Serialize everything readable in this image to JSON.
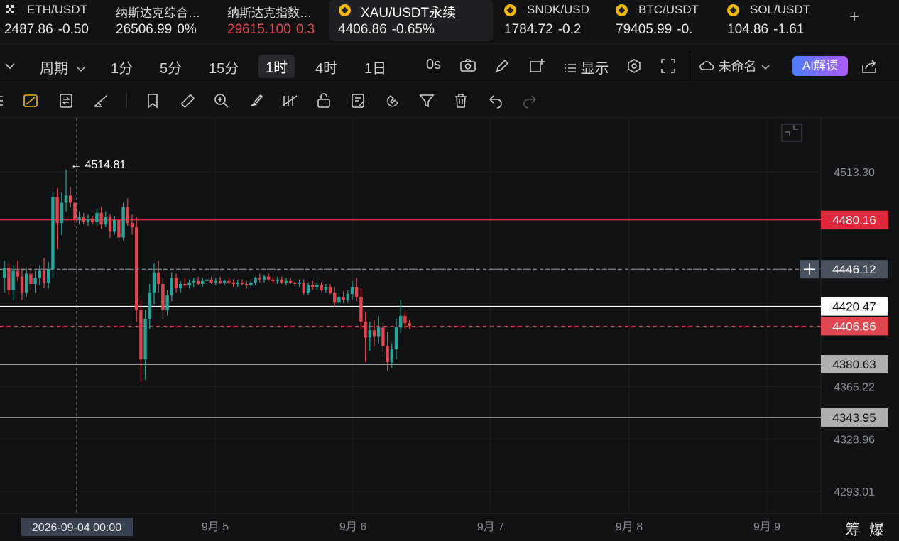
{
  "tickers": [
    {
      "name": "ETH/USDT",
      "price": "2487.86",
      "change": "-0.50",
      "change_color": "#e8e8e8",
      "price_color": "#e8e8e8",
      "icon": "grid-icon"
    },
    {
      "name": "纳斯达克综合…",
      "price": "26506.99",
      "change": "0%",
      "change_color": "#e8e8e8",
      "price_color": "#e8e8e8",
      "icon": ""
    },
    {
      "name": "纳斯达克指数…",
      "price": "29615.100",
      "change": "0.3",
      "change_color": "#e0464f",
      "price_color": "#e0464f",
      "icon": ""
    },
    {
      "name": "XAU/USDT永续",
      "price": "4406.86",
      "change": "-0.65%",
      "change_color": "#e8e8e8",
      "price_color": "#e8e8e8",
      "icon": "binance-coin-icon"
    },
    {
      "name": "SNDK/USD",
      "price": "1784.72",
      "change": "-0.2",
      "change_color": "#e8e8e8",
      "price_color": "#e8e8e8",
      "icon": "binance-coin-icon"
    },
    {
      "name": "BTC/USDT",
      "price": "79405.99",
      "change": "-0.",
      "change_color": "#e8e8e8",
      "price_color": "#e8e8e8",
      "icon": "binance-coin-icon"
    },
    {
      "name": "SOL/USDT",
      "price": "104.86",
      "change": "-1.61",
      "change_color": "#e8e8e8",
      "price_color": "#e8e8e8",
      "icon": "binance-coin-icon"
    }
  ],
  "toolbar": {
    "period_label": "周期",
    "intervals": [
      "1分",
      "5分",
      "15分",
      "1时",
      "4时",
      "1日"
    ],
    "selected_interval": "1时",
    "countdown": "0s",
    "display_label": "显示",
    "layout_name": "未命名",
    "ai_label": "AI解读"
  },
  "chart_data": {
    "type": "candlestick",
    "symbol": "XAU/USDT",
    "interval": "1h",
    "y_ticks": [
      4513.3,
      4365.22,
      4328.96,
      4293.01
    ],
    "x_ticks": [
      "9月 5",
      "9月 6",
      "9月 7",
      "9月 8",
      "9月 9"
    ],
    "crosshair_date": "2026-09-04 00:00",
    "high_marker": {
      "label": "4514.81",
      "value": 4514.81
    },
    "current_price": 4406.86,
    "crosshair_price": 4446.12,
    "price_lines": [
      {
        "label": "4480.16",
        "value": 4480.16,
        "color": "#e0283a",
        "style": "solid"
      },
      {
        "label": "4446.12",
        "value": 4446.12,
        "color": "#9aa0a8",
        "style": "dashed"
      },
      {
        "label": "4420.47",
        "value": 4420.47,
        "color": "#ffffff",
        "style": "solid"
      },
      {
        "label": "4406.86",
        "value": 4406.86,
        "color": "#e0464f",
        "style": "dashed"
      },
      {
        "label": "4380.63",
        "value": 4380.63,
        "color": "#c8c8c8",
        "style": "solid"
      },
      {
        "label": "4343.95",
        "value": 4343.95,
        "color": "#c8c8c8",
        "style": "solid"
      }
    ],
    "up_color": "#26a69a",
    "down_color": "#e0464f",
    "candles": [
      {
        "o": 4440,
        "h": 4452,
        "l": 4430,
        "c": 4447
      },
      {
        "o": 4447,
        "h": 4450,
        "l": 4428,
        "c": 4432
      },
      {
        "o": 4432,
        "h": 4449,
        "l": 4425,
        "c": 4445
      },
      {
        "o": 4445,
        "h": 4452,
        "l": 4438,
        "c": 4441
      },
      {
        "o": 4441,
        "h": 4446,
        "l": 4425,
        "c": 4430
      },
      {
        "o": 4430,
        "h": 4447,
        "l": 4427,
        "c": 4443
      },
      {
        "o": 4443,
        "h": 4450,
        "l": 4431,
        "c": 4436
      },
      {
        "o": 4436,
        "h": 4445,
        "l": 4430,
        "c": 4440
      },
      {
        "o": 4440,
        "h": 4449,
        "l": 4435,
        "c": 4445
      },
      {
        "o": 4445,
        "h": 4454,
        "l": 4433,
        "c": 4437
      },
      {
        "o": 4437,
        "h": 4451,
        "l": 4433,
        "c": 4446
      },
      {
        "o": 4446,
        "h": 4500,
        "l": 4440,
        "c": 4496
      },
      {
        "o": 4496,
        "h": 4502,
        "l": 4460,
        "c": 4478
      },
      {
        "o": 4478,
        "h": 4499,
        "l": 4470,
        "c": 4492
      },
      {
        "o": 4492,
        "h": 4515,
        "l": 4486,
        "c": 4497
      },
      {
        "o": 4497,
        "h": 4503,
        "l": 4489,
        "c": 4492
      },
      {
        "o": 4492,
        "h": 4495,
        "l": 4475,
        "c": 4480
      },
      {
        "o": 4480,
        "h": 4486,
        "l": 4477,
        "c": 4482
      },
      {
        "o": 4482,
        "h": 4485,
        "l": 4477,
        "c": 4479
      },
      {
        "o": 4479,
        "h": 4484,
        "l": 4476,
        "c": 4481
      },
      {
        "o": 4481,
        "h": 4483,
        "l": 4477,
        "c": 4479
      },
      {
        "o": 4479,
        "h": 4488,
        "l": 4476,
        "c": 4485
      },
      {
        "o": 4485,
        "h": 4489,
        "l": 4474,
        "c": 4477
      },
      {
        "o": 4477,
        "h": 4486,
        "l": 4475,
        "c": 4482
      },
      {
        "o": 4482,
        "h": 4484,
        "l": 4468,
        "c": 4472
      },
      {
        "o": 4472,
        "h": 4483,
        "l": 4470,
        "c": 4480
      },
      {
        "o": 4480,
        "h": 4482,
        "l": 4465,
        "c": 4468
      },
      {
        "o": 4468,
        "h": 4492,
        "l": 4466,
        "c": 4489
      },
      {
        "o": 4489,
        "h": 4495,
        "l": 4476,
        "c": 4478
      },
      {
        "o": 4478,
        "h": 4484,
        "l": 4470,
        "c": 4475
      },
      {
        "o": 4475,
        "h": 4482,
        "l": 4410,
        "c": 4418
      },
      {
        "o": 4418,
        "h": 4425,
        "l": 4368,
        "c": 4384
      },
      {
        "o": 4384,
        "h": 4418,
        "l": 4370,
        "c": 4412
      },
      {
        "o": 4412,
        "h": 4436,
        "l": 4405,
        "c": 4430
      },
      {
        "o": 4430,
        "h": 4450,
        "l": 4422,
        "c": 4444
      },
      {
        "o": 4444,
        "h": 4452,
        "l": 4430,
        "c": 4436
      },
      {
        "o": 4436,
        "h": 4441,
        "l": 4412,
        "c": 4418
      },
      {
        "o": 4418,
        "h": 4432,
        "l": 4414,
        "c": 4428
      },
      {
        "o": 4428,
        "h": 4444,
        "l": 4424,
        "c": 4440
      },
      {
        "o": 4440,
        "h": 4443,
        "l": 4430,
        "c": 4433
      },
      {
        "o": 4433,
        "h": 4438,
        "l": 4430,
        "c": 4436
      },
      {
        "o": 4436,
        "h": 4440,
        "l": 4433,
        "c": 4435
      },
      {
        "o": 4435,
        "h": 4439,
        "l": 4433,
        "c": 4437
      },
      {
        "o": 4437,
        "h": 4440,
        "l": 4434,
        "c": 4438
      },
      {
        "o": 4438,
        "h": 4441,
        "l": 4435,
        "c": 4436
      },
      {
        "o": 4436,
        "h": 4440,
        "l": 4434,
        "c": 4438
      },
      {
        "o": 4438,
        "h": 4441,
        "l": 4436,
        "c": 4439
      },
      {
        "o": 4439,
        "h": 4441,
        "l": 4436,
        "c": 4437
      },
      {
        "o": 4437,
        "h": 4440,
        "l": 4435,
        "c": 4438
      },
      {
        "o": 4438,
        "h": 4441,
        "l": 4436,
        "c": 4437
      },
      {
        "o": 4437,
        "h": 4439,
        "l": 4435,
        "c": 4438
      },
      {
        "o": 4438,
        "h": 4440,
        "l": 4436,
        "c": 4437
      },
      {
        "o": 4437,
        "h": 4439,
        "l": 4434,
        "c": 4436
      },
      {
        "o": 4436,
        "h": 4439,
        "l": 4434,
        "c": 4437
      },
      {
        "o": 4437,
        "h": 4439,
        "l": 4435,
        "c": 4436
      },
      {
        "o": 4436,
        "h": 4438,
        "l": 4433,
        "c": 4435
      },
      {
        "o": 4435,
        "h": 4438,
        "l": 4433,
        "c": 4437
      },
      {
        "o": 4437,
        "h": 4441,
        "l": 4435,
        "c": 4440
      },
      {
        "o": 4440,
        "h": 4443,
        "l": 4437,
        "c": 4439
      },
      {
        "o": 4439,
        "h": 4442,
        "l": 4437,
        "c": 4441
      },
      {
        "o": 4441,
        "h": 4443,
        "l": 4438,
        "c": 4439
      },
      {
        "o": 4439,
        "h": 4441,
        "l": 4436,
        "c": 4438
      },
      {
        "o": 4438,
        "h": 4441,
        "l": 4436,
        "c": 4439
      },
      {
        "o": 4439,
        "h": 4441,
        "l": 4436,
        "c": 4437
      },
      {
        "o": 4437,
        "h": 4440,
        "l": 4435,
        "c": 4438
      },
      {
        "o": 4438,
        "h": 4440,
        "l": 4436,
        "c": 4437
      },
      {
        "o": 4437,
        "h": 4439,
        "l": 4434,
        "c": 4436
      },
      {
        "o": 4436,
        "h": 4439,
        "l": 4434,
        "c": 4437
      },
      {
        "o": 4437,
        "h": 4439,
        "l": 4428,
        "c": 4430
      },
      {
        "o": 4430,
        "h": 4437,
        "l": 4428,
        "c": 4435
      },
      {
        "o": 4435,
        "h": 4438,
        "l": 4432,
        "c": 4434
      },
      {
        "o": 4434,
        "h": 4437,
        "l": 4432,
        "c": 4435
      },
      {
        "o": 4435,
        "h": 4437,
        "l": 4431,
        "c": 4432
      },
      {
        "o": 4432,
        "h": 4436,
        "l": 4430,
        "c": 4434
      },
      {
        "o": 4434,
        "h": 4436,
        "l": 4429,
        "c": 4430
      },
      {
        "o": 4430,
        "h": 4434,
        "l": 4420,
        "c": 4423
      },
      {
        "o": 4423,
        "h": 4430,
        "l": 4420,
        "c": 4427
      },
      {
        "o": 4427,
        "h": 4431,
        "l": 4423,
        "c": 4425
      },
      {
        "o": 4425,
        "h": 4432,
        "l": 4423,
        "c": 4429
      },
      {
        "o": 4429,
        "h": 4438,
        "l": 4425,
        "c": 4434
      },
      {
        "o": 4434,
        "h": 4440,
        "l": 4424,
        "c": 4427
      },
      {
        "o": 4427,
        "h": 4433,
        "l": 4405,
        "c": 4410
      },
      {
        "o": 4410,
        "h": 4417,
        "l": 4382,
        "c": 4399
      },
      {
        "o": 4399,
        "h": 4410,
        "l": 4390,
        "c": 4404
      },
      {
        "o": 4404,
        "h": 4411,
        "l": 4393,
        "c": 4400
      },
      {
        "o": 4400,
        "h": 4414,
        "l": 4395,
        "c": 4406
      },
      {
        "o": 4406,
        "h": 4409,
        "l": 4388,
        "c": 4393
      },
      {
        "o": 4393,
        "h": 4403,
        "l": 4376,
        "c": 4382
      },
      {
        "o": 4382,
        "h": 4395,
        "l": 4378,
        "c": 4391
      },
      {
        "o": 4391,
        "h": 4412,
        "l": 4384,
        "c": 4406
      },
      {
        "o": 4406,
        "h": 4425,
        "l": 4402,
        "c": 4414
      },
      {
        "o": 4414,
        "h": 4417,
        "l": 4405,
        "c": 4409
      },
      {
        "o": 4409,
        "h": 4411,
        "l": 4405,
        "c": 4407
      }
    ]
  }
}
